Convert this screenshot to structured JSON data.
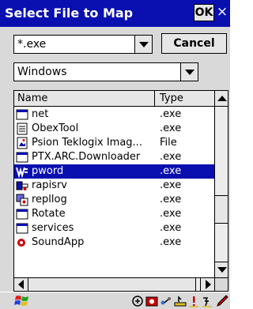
{
  "window": {
    "title": "Select File to Map",
    "ok_label": "OK",
    "close_label": "×"
  },
  "filter": {
    "value": "*.exe"
  },
  "cancel_label": "Cancel",
  "folder": {
    "value": "Windows"
  },
  "list": {
    "columns": [
      "Name",
      "Type"
    ],
    "rows": [
      {
        "name": "net",
        "type": ".exe",
        "icon": "window-icon"
      },
      {
        "name": "ObexTool",
        "type": ".exe",
        "icon": "notepad-icon"
      },
      {
        "name": "Psion Teklogix Imag...",
        "type": "File",
        "icon": "image-file-icon"
      },
      {
        "name": "PTX.ARC.Downloader",
        "type": ".exe",
        "icon": "window-icon"
      },
      {
        "name": "pword",
        "type": ".exe",
        "icon": "word-icon",
        "selected": true
      },
      {
        "name": "rapisrv",
        "type": ".exe",
        "icon": "rapi-icon"
      },
      {
        "name": "repllog",
        "type": ".exe",
        "icon": "sync-icon"
      },
      {
        "name": "Rotate",
        "type": ".exe",
        "icon": "window-icon"
      },
      {
        "name": "services",
        "type": ".exe",
        "icon": "window-icon"
      },
      {
        "name": "SoundApp",
        "type": ".exe",
        "icon": "sound-icon"
      }
    ]
  },
  "taskbar": {
    "start_icon": "windows-flag-icon",
    "tray_icons": [
      "network-icon",
      "battery-icon",
      "connection-icon",
      "keyboard-icon",
      "warning-icon",
      "input-icon",
      "pen-icon"
    ]
  },
  "colors": {
    "titlebar": "#0a0fb0",
    "selection": "#0a0fb0",
    "panel": "#d9d9d9"
  }
}
